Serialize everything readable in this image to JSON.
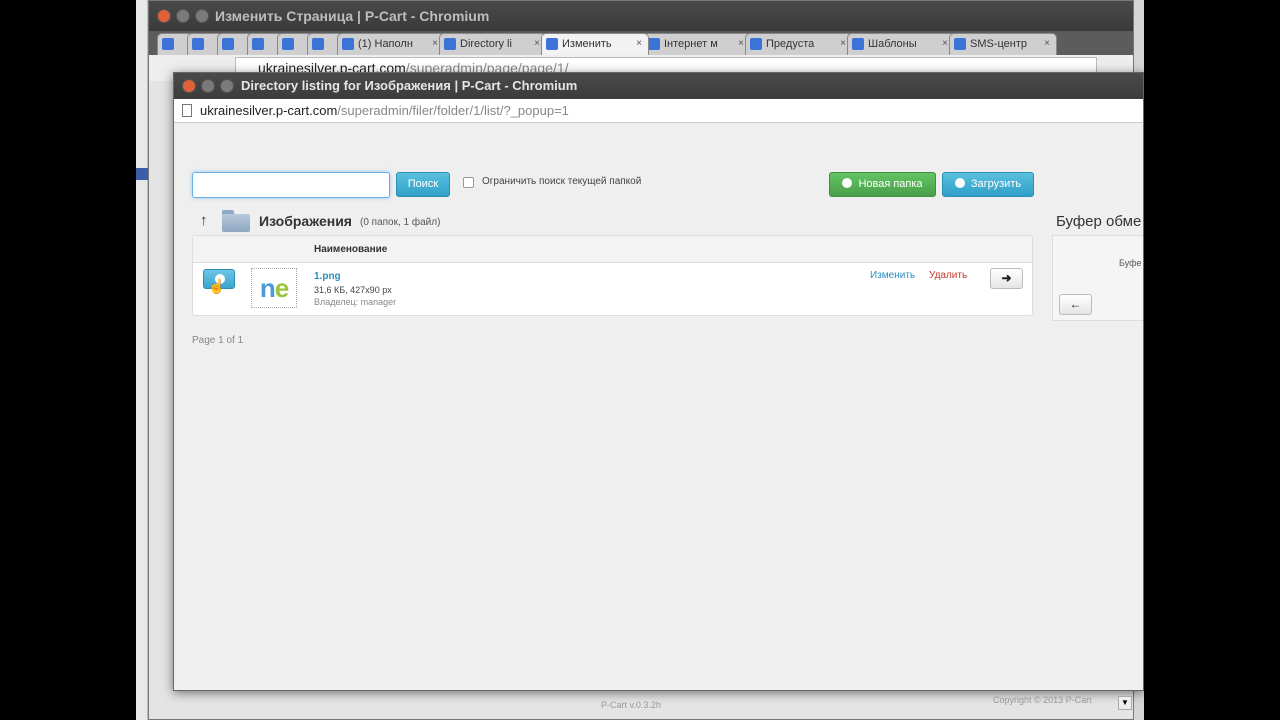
{
  "bg_window": {
    "title": "Изменить Страница | P-Cart - Chromium",
    "tabs": [
      {
        "label": "",
        "small": true
      },
      {
        "label": "",
        "small": true
      },
      {
        "label": "",
        "small": true
      },
      {
        "label": "",
        "small": true
      },
      {
        "label": "",
        "small": true
      },
      {
        "label": "",
        "small": true
      },
      {
        "label": "(1) Наполн",
        "small": false
      },
      {
        "label": "Directory li",
        "small": false
      },
      {
        "label": "Изменить",
        "small": false
      },
      {
        "label": "Інтернет м",
        "small": false
      },
      {
        "label": "Предуста",
        "small": false
      },
      {
        "label": "Шаблоны",
        "small": false
      },
      {
        "label": "SMS-центр",
        "small": false
      }
    ],
    "url_host": "ukrainesilver.p-cart.com",
    "url_path": "/superadmin/page/page/1/"
  },
  "popup": {
    "title": "Directory listing for Изображения | P-Cart - Chromium",
    "url_host": "ukrainesilver.p-cart.com",
    "url_path": "/superadmin/filer/folder/1/list/?_popup=1"
  },
  "toolbar": {
    "search_value": "",
    "search_button": "Поиск",
    "limit_label": "Ограничить поиск текущей папкой",
    "new_folder_button": "Новая папка",
    "upload_button": "Загрузить"
  },
  "folder": {
    "name": "Изображения",
    "meta": "(0 папок, 1 файл)"
  },
  "table": {
    "column_name": "Наименование",
    "rows": [
      {
        "filename": "1.png",
        "size": "31,6 КБ, 427x90 px",
        "owner": "Владелец: manager",
        "edit": "Изменить",
        "delete": "Удалить"
      }
    ]
  },
  "pager": "Page 1 of 1",
  "clipboard": {
    "title": "Буфер обме",
    "text": "Буфе"
  },
  "footer": {
    "version": "P-Cart v.0.3.2h",
    "copyright": "Copyright © 2013 P-Cart"
  }
}
